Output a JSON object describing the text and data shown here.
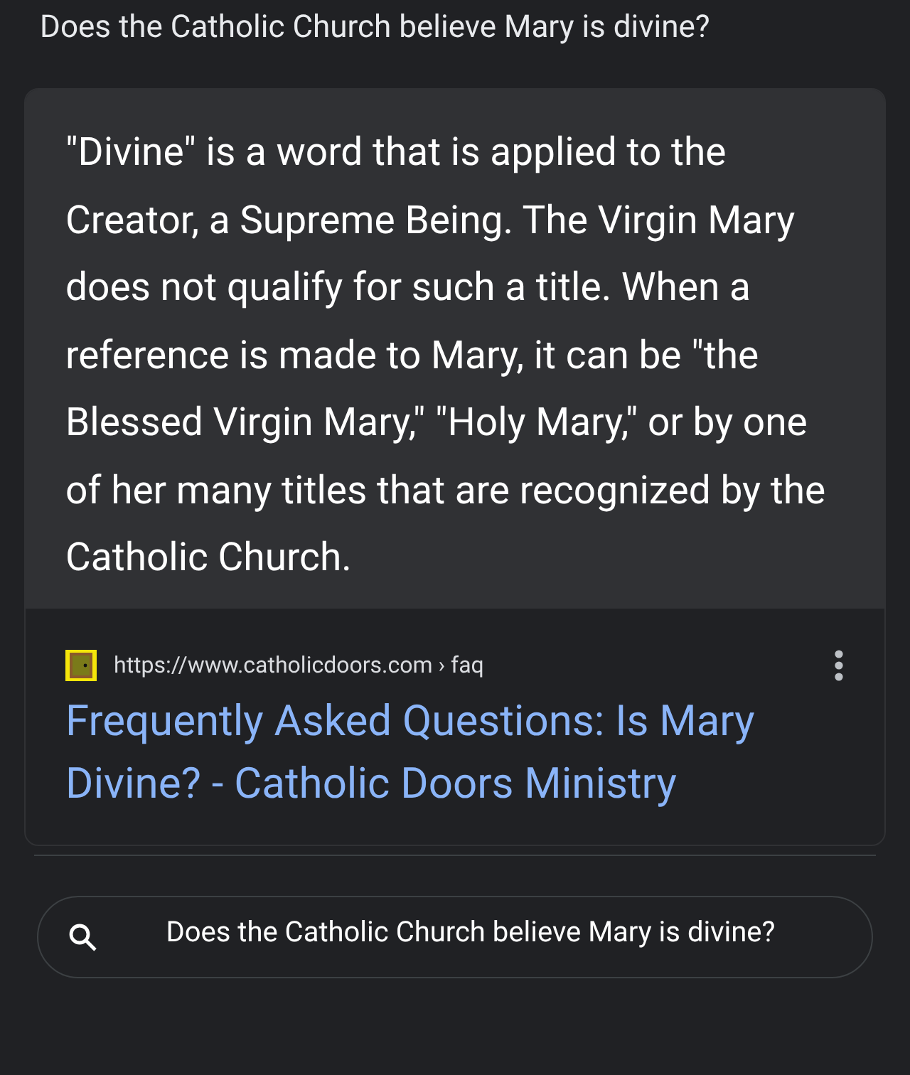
{
  "question": "Does the Catholic Church believe Mary is divine?",
  "answer": "\"Divine\" is a word that is applied to the Creator, a Supreme Being. The Virgin Mary does not qualify for such a title. When a reference is made to Mary, it can be \"the Blessed Virgin Mary,\" \"Holy Mary,\" or by one of her many titles that are recognized by the Catholic Church.",
  "source": {
    "url": "https://www.catholicdoors.com",
    "path": "› faq",
    "title": "Frequently Asked Questions: Is Mary Divine? - Catholic Doors Ministry"
  },
  "search_bar": {
    "value": "Does the Catholic Church believe Mary is divine?"
  }
}
